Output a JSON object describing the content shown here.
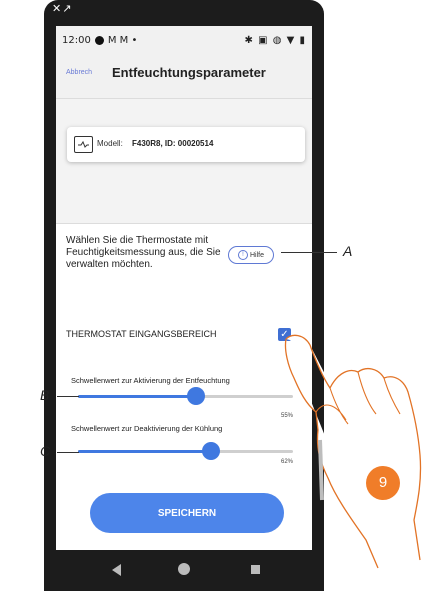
{
  "status": {
    "time": "12:00",
    "right_icons": "✱ ▣ ◍ ▼ ▮"
  },
  "header": {
    "cancel_label": "Abbrech",
    "title": "Entfeuchtungsparameter"
  },
  "device": {
    "model_label": "Modell:",
    "model_value": "F430R8, ID: 00020514"
  },
  "help": {
    "text": "Wählen Sie die Thermostate mit Feuchtigkeitsmessung aus, die Sie verwalten möchten.",
    "button_label": "Hilfe"
  },
  "group": {
    "label": "THERMOSTAT EINGANGSBEREICH",
    "checked": true
  },
  "sliders": [
    {
      "label": "Schwellenwert zur Aktivierung der Entfeuchtung",
      "value_text": "55%",
      "value": 55
    },
    {
      "label": "Schwellenwert zur Deaktivierung der Kühlung",
      "value_text": "62%",
      "value": 62
    }
  ],
  "save_label": "SPEICHERN",
  "callouts": {
    "a": "A",
    "b": "B",
    "c": "C"
  },
  "step_badge": "9",
  "colors": {
    "accent": "#3f78e0",
    "badge": "#f07d29"
  }
}
